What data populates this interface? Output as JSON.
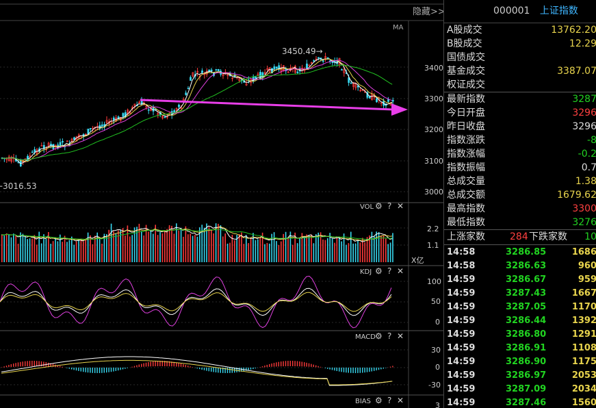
{
  "chart_header": {
    "hide_label": "隐藏>>",
    "ma_label": "MA"
  },
  "price_axis": {
    "ticks": [
      "3400",
      "3300",
      "3200",
      "3100",
      "3000"
    ]
  },
  "annotations": {
    "high": "3450.49→",
    "low": "←3016.53"
  },
  "vol_panel": {
    "title": "VOL",
    "ticks": [
      "2.2",
      "1.1"
    ],
    "unit": "X亿"
  },
  "kdj_panel": {
    "title": "KDJ",
    "ticks": [
      "100",
      "50",
      "0"
    ]
  },
  "macd_panel": {
    "title": "MACD",
    "ticks": [
      "30",
      "0",
      "-30"
    ]
  },
  "bias_panel": {
    "title": "BIAS",
    "ticks": [
      "3"
    ]
  },
  "panel_icons": {
    "gear": "⚙",
    "help": "?",
    "close": "✕"
  },
  "colors": {
    "up": "#ff3b3b",
    "down": "#38d8f0",
    "arrow": "#e83ee8",
    "ma5": "#ffffff",
    "ma10": "#e8d44d",
    "ma20": "#e040e0",
    "ma60": "#21c121"
  },
  "index": {
    "code": "000001",
    "name": "上证指数"
  },
  "trade_stats": [
    {
      "label": "A股成交",
      "value": "13762.20",
      "color": "y"
    },
    {
      "label": "B股成交",
      "value": "12.29",
      "color": "y"
    },
    {
      "label": "国债成交",
      "value": "",
      "color": "y"
    },
    {
      "label": "基金成交",
      "value": "3387.07",
      "color": "y"
    },
    {
      "label": "权证成交",
      "value": "",
      "color": "y"
    }
  ],
  "index_stats": [
    {
      "label": "最新指数",
      "value": "3287",
      "color": "g"
    },
    {
      "label": "今日开盘",
      "value": "3296",
      "color": "r"
    },
    {
      "label": "昨日收盘",
      "value": "3296",
      "color": "w"
    },
    {
      "label": "指数涨跌",
      "value": "-8",
      "color": "g"
    },
    {
      "label": "指数涨幅",
      "value": "-0.2",
      "color": "g"
    },
    {
      "label": "指数振幅",
      "value": "0.7",
      "color": "w"
    },
    {
      "label": "总成交量",
      "value": "1.38",
      "color": "y"
    },
    {
      "label": "总成交额",
      "value": "1679.62",
      "color": "y"
    },
    {
      "label": "最高指数",
      "value": "3300",
      "color": "r"
    },
    {
      "label": "最低指数",
      "value": "3276",
      "color": "g"
    }
  ],
  "advance": {
    "up_label": "上涨家数",
    "up_value": "284",
    "down_label": "下跌家数",
    "down_value": "10"
  },
  "ticks": [
    {
      "time": "14:58",
      "price": "3286.85",
      "vol": "1686"
    },
    {
      "time": "14:58",
      "price": "3286.63",
      "vol": "960"
    },
    {
      "time": "14:59",
      "price": "3286.67",
      "vol": "959"
    },
    {
      "time": "14:59",
      "price": "3287.43",
      "vol": "1667"
    },
    {
      "time": "14:59",
      "price": "3287.05",
      "vol": "1170"
    },
    {
      "time": "14:59",
      "price": "3286.44",
      "vol": "1392"
    },
    {
      "time": "14:59",
      "price": "3286.80",
      "vol": "1291"
    },
    {
      "time": "14:59",
      "price": "3286.91",
      "vol": "1108"
    },
    {
      "time": "14:59",
      "price": "3286.90",
      "vol": "1175"
    },
    {
      "time": "14:59",
      "price": "3286.97",
      "vol": "2053"
    },
    {
      "time": "14:59",
      "price": "3287.09",
      "vol": "2034"
    },
    {
      "time": "14:59",
      "price": "3287.46",
      "vol": "1560"
    }
  ]
}
